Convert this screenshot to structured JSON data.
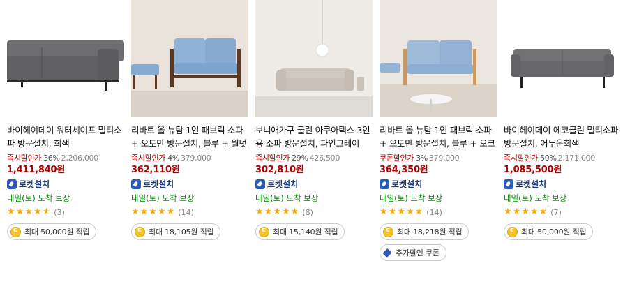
{
  "products": [
    {
      "name": "바이헤이데이 워터세이프 멀티소파 방문설치, 회색",
      "discount_type": "즉시할인가",
      "discount_pct": "36%",
      "original_price": "2,206,000",
      "price": "1,411,840원",
      "badge": "로켓설치",
      "delivery": "내일(토) 도착 보장",
      "rating": 4.5,
      "review_count": "(3)",
      "reward": "최대 50,000원 적립",
      "coupon": null
    },
    {
      "name": "리바트 올 뉴탐 1인 패브릭 소파 + 오토만 방문설치, 블루 + 월넛",
      "discount_type": "즉시할인가",
      "discount_pct": "4%",
      "original_price": "379,000",
      "price": "362,110원",
      "badge": "로켓설치",
      "delivery": "내일(토) 도착 보장",
      "rating": 5,
      "review_count": "(14)",
      "reward": "최대 18,105원 적립",
      "coupon": null
    },
    {
      "name": "보니애가구 쿨린 아쿠아텍스 3인용 소파 방문설치, 파인그레이",
      "discount_type": "즉시할인가",
      "discount_pct": "29%",
      "original_price": "426,500",
      "price": "302,810원",
      "badge": "로켓설치",
      "delivery": "내일(토) 도착 보장",
      "rating": 5,
      "review_count": "(8)",
      "reward": "최대 15,140원 적립",
      "coupon": null
    },
    {
      "name": "리바트 올 뉴탐 1인 패브릭 소파 + 오토만 방문설치, 블루 + 오크",
      "discount_type": "쿠폰할인가",
      "discount_pct": "3%",
      "original_price": "379,000",
      "price": "364,350원",
      "badge": "로켓설치",
      "delivery": "내일(토) 도착 보장",
      "rating": 5,
      "review_count": "(14)",
      "reward": "최대 18,218원 적립",
      "coupon": "추가할인 쿠폰"
    },
    {
      "name": "바이헤이데이 에코클린 멀티소파 방문설치, 어두운회색",
      "discount_type": "즉시할인가",
      "discount_pct": "50%",
      "original_price": "2,171,000",
      "price": "1,085,500원",
      "badge": "로켓설치",
      "delivery": "내일(토) 도착 보장",
      "rating": 5,
      "review_count": "(7)",
      "reward": "최대 50,000원 적립",
      "coupon": null
    }
  ],
  "colors": {
    "price": "#ae0000",
    "delivery": "#008c00",
    "star": "#f6a700",
    "rocket": "#1d3d73"
  }
}
